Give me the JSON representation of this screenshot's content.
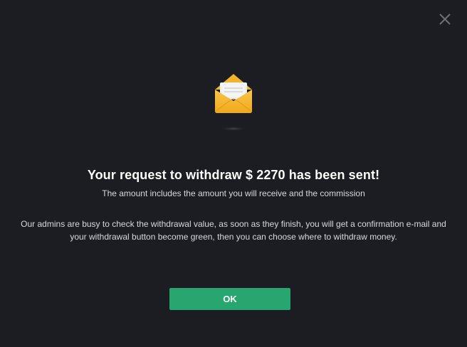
{
  "dialog": {
    "title": "Your request to withdraw $ 2270 has been sent!",
    "subtitle": "The amount includes the amount you will receive and the commission",
    "message": "Our admins are busy to check the withdrawal value, as soon as they finish, you will get a confirmation e-mail and your withdrawal button become green, then you can choose where to withdraw money.",
    "ok_label": "OK",
    "close_icon": "close-icon",
    "envelope_icon": "envelope-icon"
  },
  "colors": {
    "background": "#1b1d23",
    "accent": "#27a670",
    "envelope": "#f6b731"
  }
}
